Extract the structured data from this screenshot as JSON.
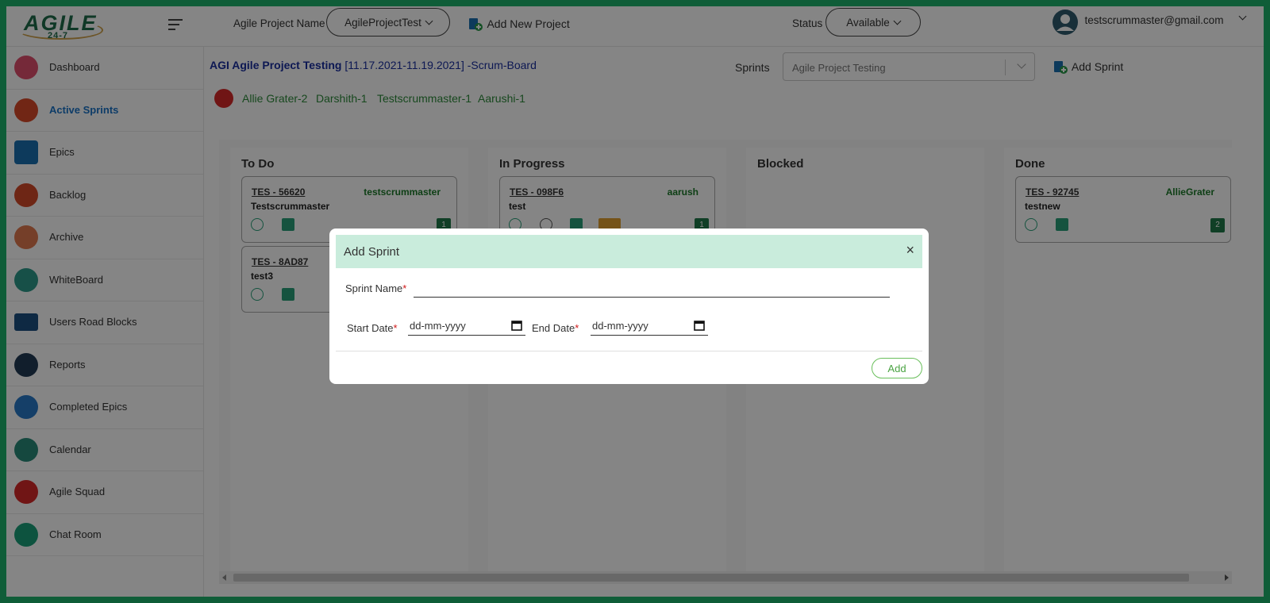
{
  "app": {
    "logo_text": "AGILE",
    "logo_sub": "24-7"
  },
  "sidebar": {
    "items": [
      {
        "label": "Dashboard",
        "color": "#e0506e"
      },
      {
        "label": "Active Sprints",
        "color": "#d94a2a"
      },
      {
        "label": "Epics",
        "color": "#1a6fb0"
      },
      {
        "label": "Backlog",
        "color": "#d44a2a"
      },
      {
        "label": "Archive",
        "color": "#e07a50"
      },
      {
        "label": "WhiteBoard",
        "color": "#2c9a8a"
      },
      {
        "label": "Users Road Blocks",
        "color": "#1b4f80"
      },
      {
        "label": "Reports",
        "color": "#223a55"
      },
      {
        "label": "Completed Epics",
        "color": "#2a7ac8"
      },
      {
        "label": "Calendar",
        "color": "#2a8a7a"
      },
      {
        "label": "Agile Squad",
        "color": "#d62a2a"
      },
      {
        "label": "Chat Room",
        "color": "#1aa07a"
      }
    ],
    "active": "Active Sprints"
  },
  "header": {
    "project_label": "Agile Project Name",
    "project_value": "AgileProjectTest",
    "add_project": "Add New Project",
    "status_label": "Status",
    "status_value": "Available",
    "user_email": "testscrummaster@gmail.com"
  },
  "sprint_bar": {
    "title_bold": "AGI Agile Project Testing",
    "title_rest": "[11.17.2021-11.19.2021] -Scrum-Board",
    "sprints_label": "Sprints",
    "sprints_value": "Agile Project Testing",
    "add_sprint": "Add Sprint"
  },
  "members": [
    "Allie Grater-2",
    "Darshith-1",
    "Testscrummaster-1",
    "Aarushi-1"
  ],
  "board": {
    "columns": [
      {
        "title": "To Do",
        "cards": [
          {
            "id": "TES - 56620",
            "assignee": "testscrummaster",
            "desc": "Testscrummaster",
            "count": "1"
          },
          {
            "id": "TES - 8AD87",
            "assignee": "",
            "desc": "test3",
            "count": ""
          }
        ]
      },
      {
        "title": "In Progress",
        "cards": [
          {
            "id": "TES - 098F6",
            "assignee": "aarush",
            "desc": "test",
            "count": "1"
          }
        ]
      },
      {
        "title": "Blocked",
        "cards": []
      },
      {
        "title": "Done",
        "cards": [
          {
            "id": "TES - 92745",
            "assignee": "AllieGrater",
            "desc": "testnew",
            "count": "2"
          }
        ]
      }
    ]
  },
  "modal": {
    "title": "Add Sprint",
    "close": "×",
    "sprint_name_label": "Sprint Name",
    "required_mark": "*",
    "start_date_label": "Start Date",
    "end_date_label": "End Date",
    "date_placeholder": "dd-mm-yyyy",
    "add_button": "Add"
  }
}
